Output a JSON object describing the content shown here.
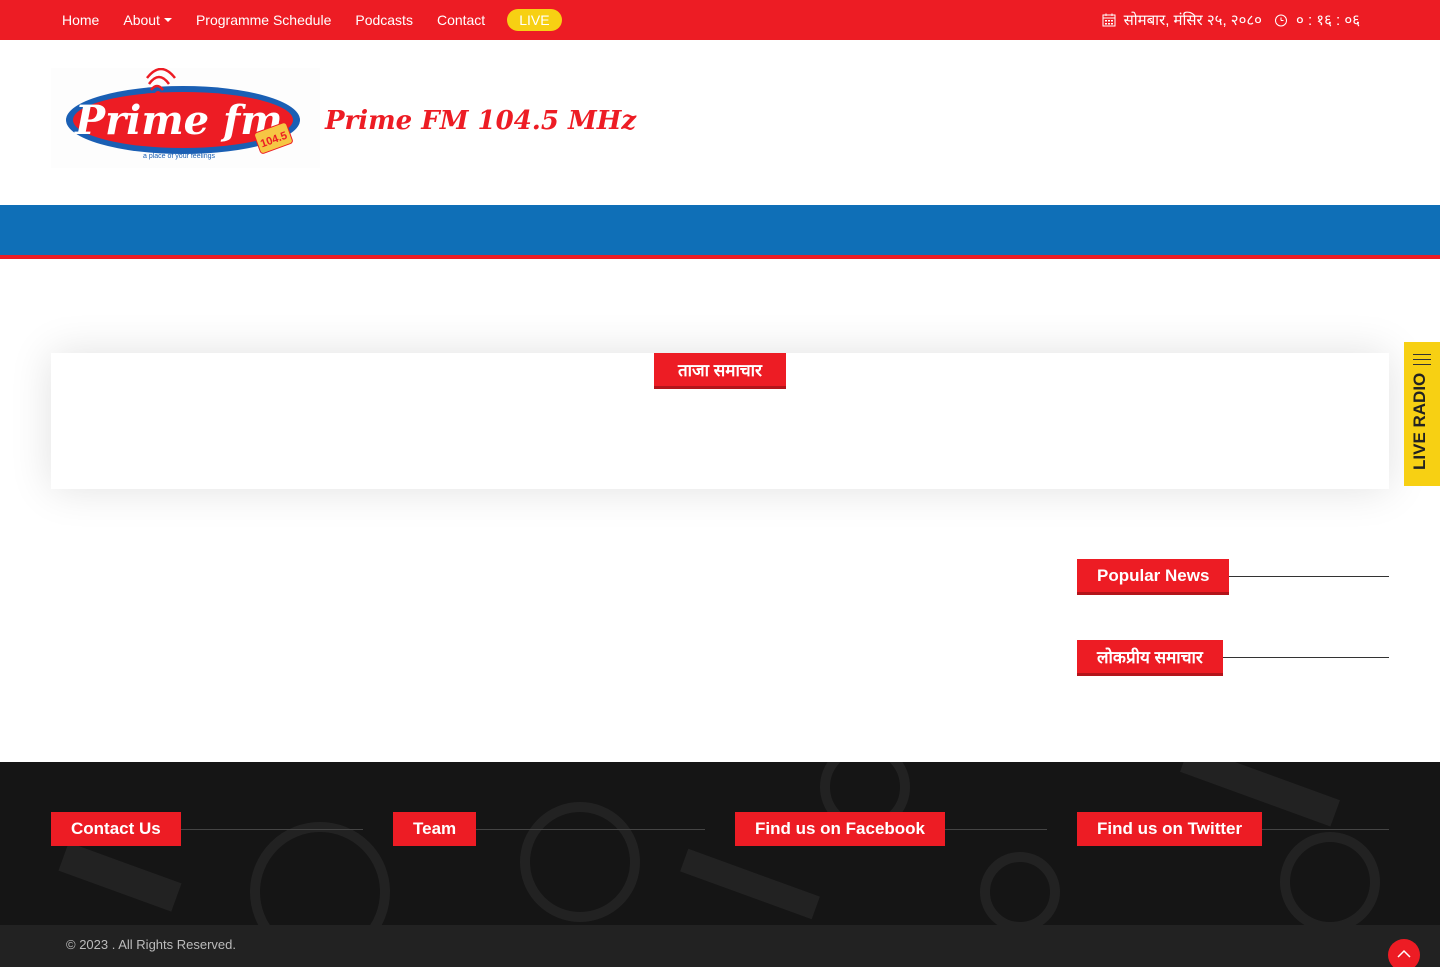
{
  "topbar": {
    "nav": [
      {
        "label": "Home"
      },
      {
        "label": "About"
      },
      {
        "label": "Programme Schedule"
      },
      {
        "label": "Podcasts"
      },
      {
        "label": "Contact"
      }
    ],
    "live_label": "LIVE",
    "date": "सोमबार, मंसिर २५, २०८०",
    "time": "० : १६ : ०६",
    "accent": "#ed1c24",
    "live_color": "#f7d013"
  },
  "header": {
    "logo_brand": "Prime fm",
    "logo_freq": "104.5",
    "logo_tagline": "a place of your feelings",
    "site_title": "Prime FM 104.5 MHz"
  },
  "news": {
    "tab_title": "ताजा समाचार"
  },
  "live_radio": {
    "label": "LIVE RADIO"
  },
  "sidebar": {
    "popular_news": "Popular News",
    "popular_news_np": "लोकप्रीय समाचार"
  },
  "footer": {
    "contact": "Contact Us",
    "team": "Team",
    "facebook": "Find us on Facebook",
    "twitter": "Find us on Twitter",
    "copyright": "© 2023 . All Rights Reserved."
  },
  "icons": [
    "calendar-icon",
    "clock-icon",
    "menu-icon",
    "chevron-up-icon",
    "caret-down-icon"
  ],
  "colors": {
    "blue_bar": "#0f6fb7",
    "footer_bg": "#151515"
  }
}
